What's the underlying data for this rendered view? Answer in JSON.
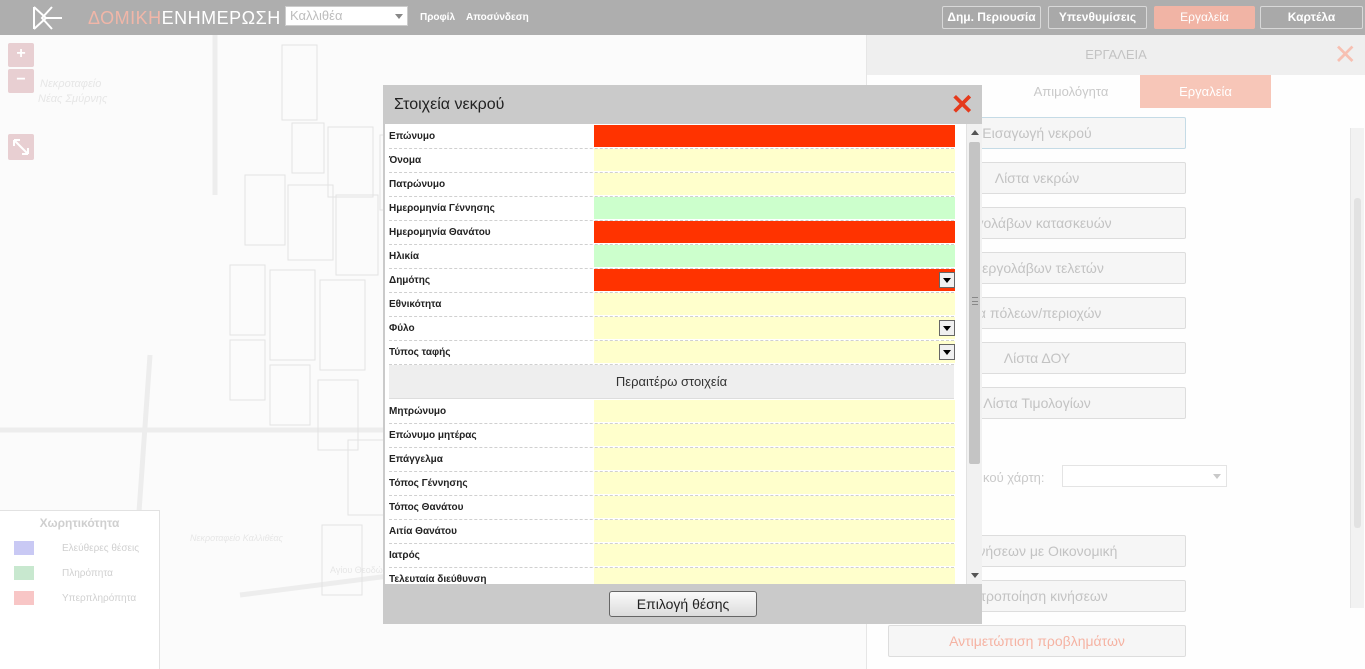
{
  "topbar": {
    "brand_part1": "ΔΟΜΙΚΗ",
    "brand_part2": "ΕΝΗΜΕΡΩΣΗ",
    "city_selected": "Καλλιθέα",
    "link_profile": "Προφίλ",
    "link_logout": "Αποσύνδεση",
    "buttons": [
      "Δημ. Περιουσία",
      "Υπενθυμίσεις",
      "Εργαλεία",
      "Καρτέλα"
    ],
    "active_button": "Εργαλεία"
  },
  "map": {
    "zoom_in": "+",
    "zoom_out": "−",
    "fullscreen_icon": "expand-arrows-icon",
    "label_cemetery": "Νεκροταφείο",
    "label_area": "Νέας Σμύρνης",
    "label_small": "Νεκροταφείο Καλλιθέας",
    "street_label": "Αγίου Θεοδώρων",
    "legend": {
      "title": "Χωρητικότητα",
      "items": [
        {
          "label": "Ελεύθερες θέσεις",
          "color": "#c9c9f4"
        },
        {
          "label": "Πληρόπητα",
          "color": "#c8e8cf"
        },
        {
          "label": "Υπερπληρόπητα",
          "color": "#f8c6c6"
        }
      ]
    }
  },
  "panel": {
    "title": "ΕΡΓΑΛΕΙΑ",
    "close": "✕",
    "tabs": [
      "Απιμολόγητα",
      "Εργαλεία"
    ],
    "active_tab": "Εργαλεία",
    "buttons": [
      "Εισαγωγή νεκρού",
      "Λίστα νεκρών",
      "εργολάβων κατασκευών",
      "α εργολάβων τελετών",
      "τα πόλεων/περιοχών",
      "Λίστα ΔΟΥ",
      "Λίστα Τιμολογίων"
    ],
    "map_select_label": "κού χάρτη:",
    "bottom_buttons": [
      "η κινήσεων με Οικονομική",
      "μετροποίηση κινήσεων",
      "Αντιμετώπιση προβλημάτων"
    ]
  },
  "modal": {
    "title": "Στοιχεία νεκρού",
    "close": "✕",
    "fields": [
      {
        "label": "Επώνυμο",
        "state": "req",
        "dropdown": false
      },
      {
        "label": "Όνομα",
        "state": "opt",
        "dropdown": false
      },
      {
        "label": "Πατρώνυμο",
        "state": "opt",
        "dropdown": false
      },
      {
        "label": "Ημερομηνία Γέννησης",
        "state": "ok",
        "dropdown": false
      },
      {
        "label": "Ημερομηνία Θανάτου",
        "state": "req",
        "dropdown": false
      },
      {
        "label": "Ηλικία",
        "state": "ok",
        "dropdown": false
      },
      {
        "label": "Δημότης",
        "state": "req",
        "dropdown": true
      },
      {
        "label": "Εθνικότητα",
        "state": "opt",
        "dropdown": false
      },
      {
        "label": "Φύλο",
        "state": "opt",
        "dropdown": true
      },
      {
        "label": "Τύπος ταφής",
        "state": "opt",
        "dropdown": true
      }
    ],
    "section_title": "Περαιτέρω στοιχεία",
    "extra_fields": [
      {
        "label": "Μητρώνυμο",
        "state": "opt"
      },
      {
        "label": "Επώνυμο μητέρας",
        "state": "opt"
      },
      {
        "label": "Επάγγελμα",
        "state": "opt"
      },
      {
        "label": "Τόπος Γέννησης",
        "state": "opt"
      },
      {
        "label": "Τόπος Θανάτου",
        "state": "opt"
      },
      {
        "label": "Αιτία Θανάτου",
        "state": "opt"
      },
      {
        "label": "Ιατρός",
        "state": "opt"
      },
      {
        "label": "Τελευταία διεύθυνση",
        "state": "opt"
      }
    ],
    "colors": {
      "required": "#ff3300",
      "optional": "#ffffcc",
      "valid": "#ccffcc"
    },
    "choose_button": "Επιλογή θέσης"
  }
}
